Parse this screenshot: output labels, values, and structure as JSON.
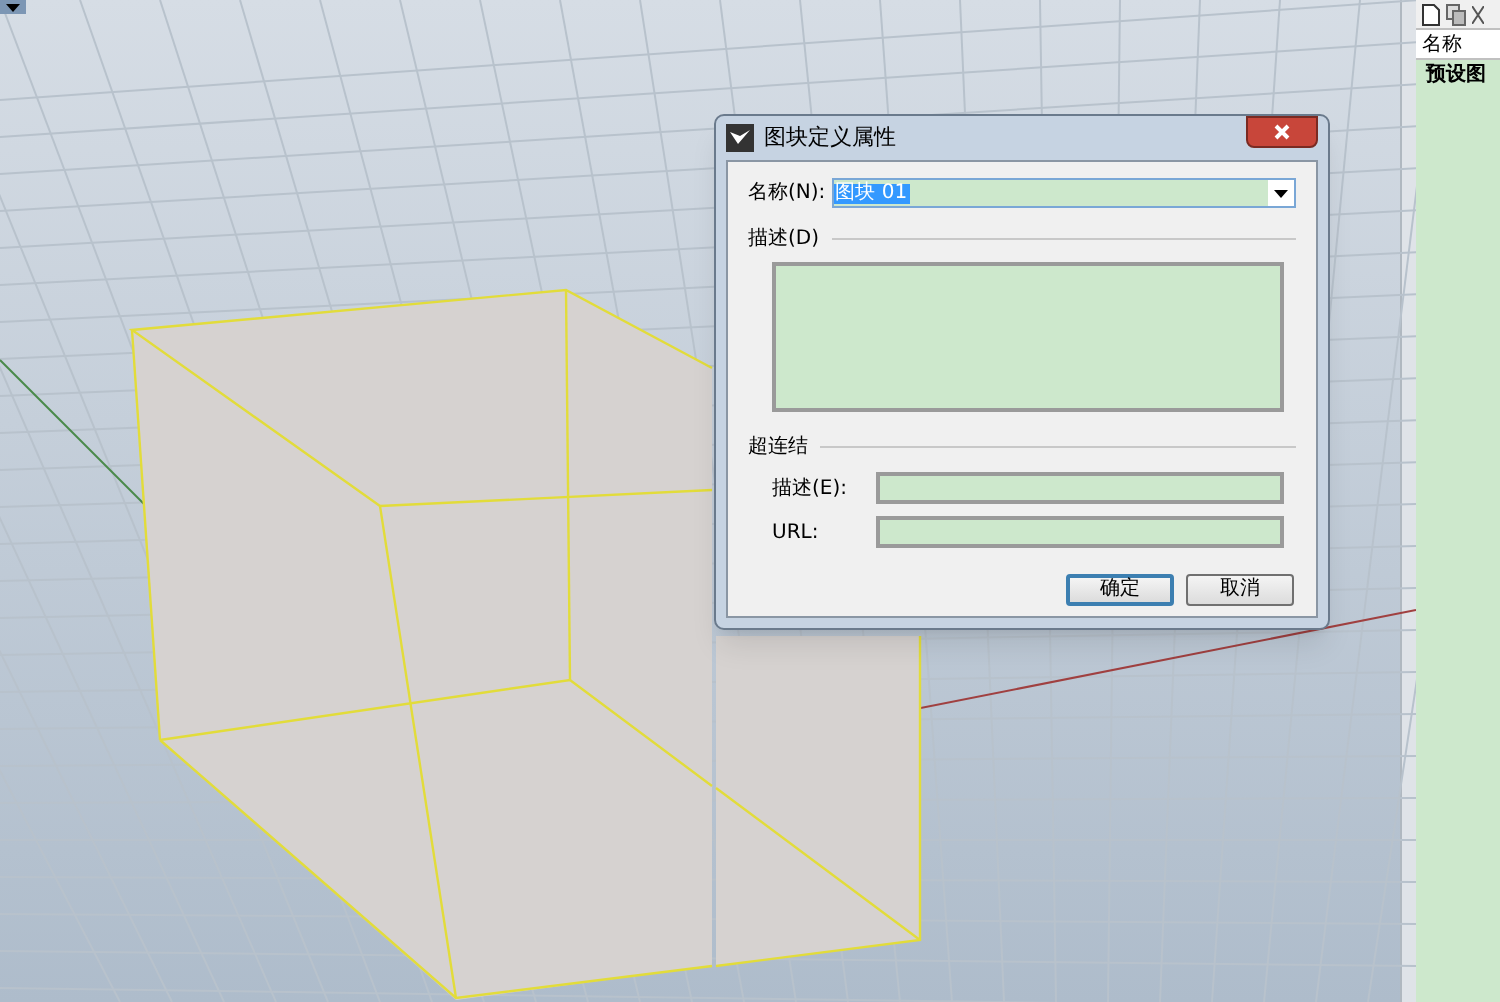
{
  "dialog": {
    "title": "图块定义属性",
    "name_label": "名称(N):",
    "name_value": "图块 01",
    "name_value_selected": true,
    "description_group": "描述(D)",
    "hyperlink_group": "超连结",
    "hyperlink_fields": [
      {
        "label": "描述(E):"
      },
      {
        "label": "URL:"
      }
    ],
    "buttons": [
      {
        "label": "确定",
        "default": true
      },
      {
        "label": "取消",
        "default": false
      }
    ]
  },
  "layers_panel": {
    "column_header": "名称",
    "rows": [
      {
        "name": "预设图"
      }
    ]
  }
}
